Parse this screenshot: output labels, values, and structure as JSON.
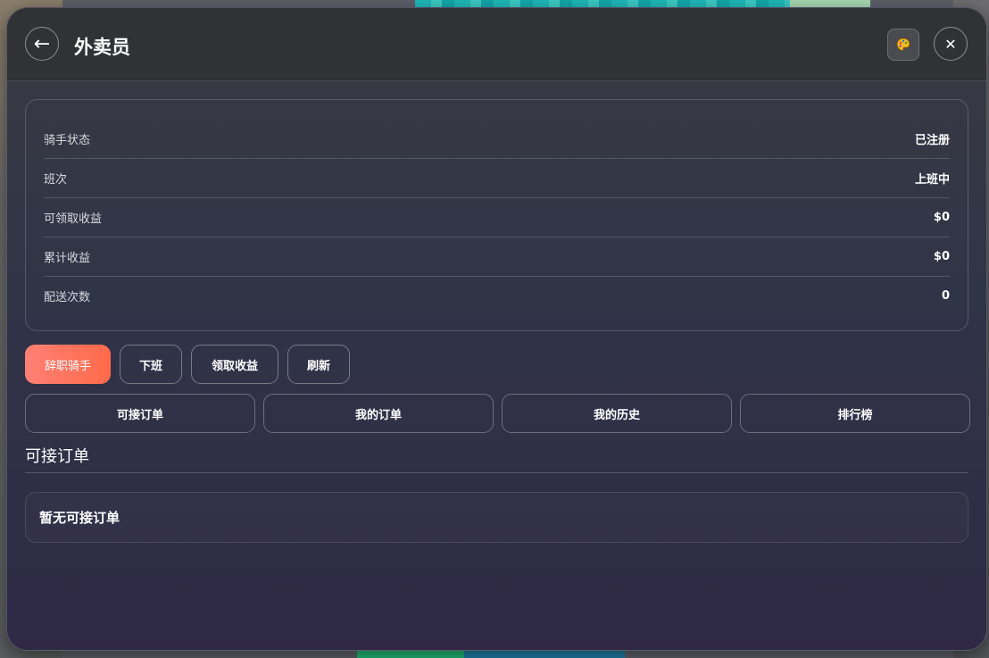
{
  "header": {
    "title": "外卖员",
    "back_icon": "←",
    "close_icon": "✕"
  },
  "info": {
    "rows": [
      {
        "label": "骑手状态",
        "value": "已注册"
      },
      {
        "label": "班次",
        "value": "上班中"
      },
      {
        "label": "可领取收益",
        "value": "$0"
      },
      {
        "label": "累计收益",
        "value": "$0"
      },
      {
        "label": "配送次数",
        "value": "0"
      }
    ]
  },
  "actions": {
    "resign": "辞职骑手",
    "off_duty": "下班",
    "claim": "领取收益",
    "refresh": "刷新"
  },
  "tabs": [
    "可接订单",
    "我的订单",
    "我的历史",
    "排行榜"
  ],
  "section": {
    "title": "可接订单",
    "empty_text": "暂无可接订单"
  },
  "colors": {
    "danger_start": "#ff8075",
    "danger_end": "#ff6a4a",
    "panel_top": "#393b42",
    "panel_bottom": "#2f2945"
  }
}
